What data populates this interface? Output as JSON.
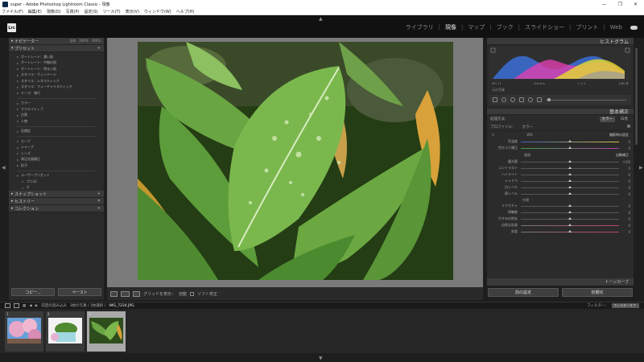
{
  "window": {
    "title": "super - Adobe Photoshop Lightroom Classic - 現像",
    "controls": [
      "—",
      "❐",
      "✕"
    ]
  },
  "menu": [
    "ファイル(F)",
    "編集(E)",
    "現像(D)",
    "写真(P)",
    "設定(S)",
    "ツール(T)",
    "表示(V)",
    "ウィンドウ(W)",
    "ヘルプ(H)"
  ],
  "logo": "Lrc",
  "modules": {
    "items": [
      "ライブラリ",
      "現像",
      "マップ",
      "ブック",
      "スライドショー",
      "プリント",
      "Web"
    ],
    "active": "現像"
  },
  "left_panel": {
    "navigator": {
      "label": "ナビゲーター",
      "zooms": [
        "全体",
        "100%",
        "300%"
      ]
    },
    "presets": {
      "label": "プリセット",
      "groups": [
        [
          "ポートレート：濃い肌",
          "ポートレート：中間の肌",
          "ポートレート：明るい肌",
          "スタイル：ヴィンテージ",
          "スタイル：シネマティック",
          "スタイル：フューチャリスティック",
          "テーマ：旅行"
        ],
        [
          "カラー",
          "クリエイティブ",
          "白黒",
          "人物"
        ],
        [
          "旧規定"
        ],
        [
          "カーブ",
          "シャープ",
          "レンズ",
          "周辺光量補正",
          "粒子"
        ],
        [
          "ユーザープリセット"
        ]
      ],
      "user_sub": [
        "プ二x2",
        "グ"
      ]
    },
    "snapshot": "スナップショット",
    "history": "ヒストリー",
    "collection": "コレクション",
    "copy_button": "コピー...",
    "paste_button": "ペースト"
  },
  "toolbar": {
    "grid_label": "グリッドを表示：",
    "auto_label": "自動",
    "soft_proof": "ソフト校正"
  },
  "right_panel": {
    "histogram_label": "ヒストグラム",
    "histo_readout": [
      "ISO 11",
      "4.6 mm",
      "f / 1.1",
      "1/60 秒"
    ],
    "original_photo": "元の写真",
    "basic_label": "基本補正",
    "treatment_label": "処理方法：",
    "treatment_options": [
      "カラー",
      "白黒"
    ],
    "treatment_selected": "カラー",
    "profile_label": "プロファイル：",
    "profile_value": "カラー",
    "wb_label": "WB：",
    "wb_value": "撮影時の設定",
    "temp_label": "色温度",
    "tint_label": "色かぶり補正",
    "tone_label": "階調",
    "tone_auto": "自動補正",
    "exposure_label": "露光量",
    "contrast_label": "コントラスト",
    "highlights_label": "ハイライト",
    "shadows_label": "シャドウ",
    "whites_label": "白レベル",
    "blacks_label": "黒レベル",
    "presence_label": "外観",
    "texture_label": "テクスチャ",
    "clarity_label": "明瞭度",
    "dehaze_label": "かすみの除去",
    "vibrance_label": "自然な彩度",
    "saturation_label": "彩度",
    "tone_curve_label": "トーンカーブ",
    "prev_button": "前の設定",
    "reset_button": "初期化",
    "values": {
      "temp": "0",
      "tint": "0",
      "exposure": "0.00",
      "contrast": "0",
      "highlights": "0",
      "shadows": "0",
      "whites": "0",
      "blacks": "0",
      "texture": "0",
      "clarity": "0",
      "dehaze": "0",
      "vibrance": "0",
      "saturation": "0"
    }
  },
  "filmstrip": {
    "source_text": "前回の読み込み",
    "count_text": "3枚の写真 / 1枚選択 /",
    "filename": "IMG_7224.JPG",
    "filter_label": "フィルター：",
    "filter_value": "フィルターオフ",
    "thumb_numbers": [
      "1",
      "2",
      "3"
    ]
  }
}
